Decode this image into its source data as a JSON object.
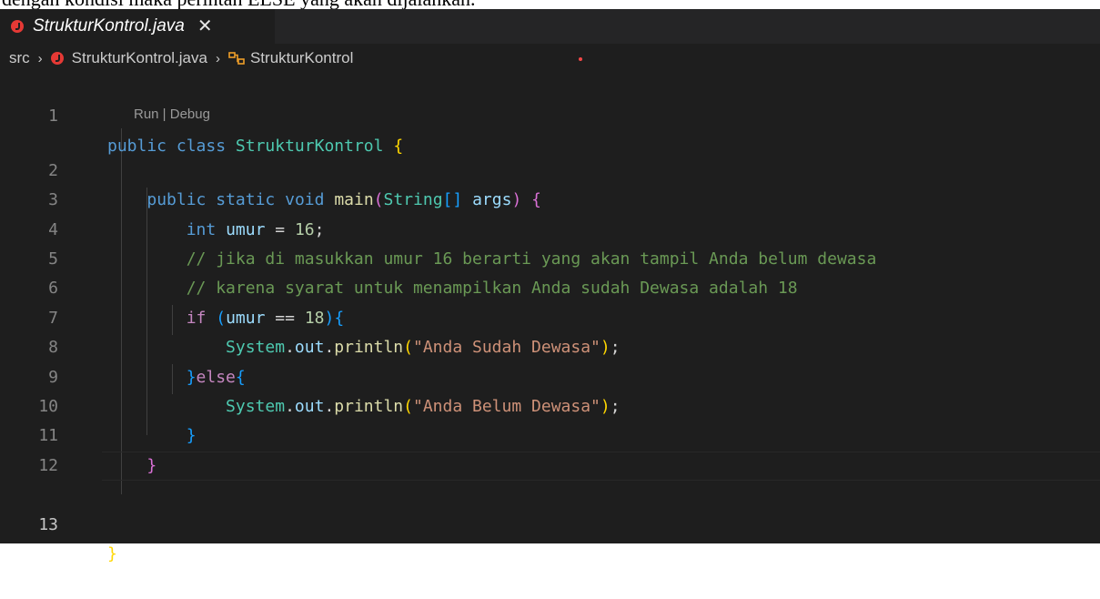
{
  "document_text": "dengan kondisi maka perintah ELSE yang akan dijalankan.",
  "tab": {
    "title": "StrukturKontrol.java",
    "close_glyph": "✕"
  },
  "breadcrumb": {
    "folder": "src",
    "file": "StrukturKontrol.java",
    "symbol": "StrukturKontrol",
    "separator": "›"
  },
  "codelens": "Run | Debug",
  "line_numbers": [
    "1",
    "2",
    "3",
    "4",
    "5",
    "6",
    "7",
    "8",
    "9",
    "10",
    "11",
    "12",
    "13"
  ],
  "code": {
    "l1": {
      "kw1": "public",
      "kw2": "class",
      "name": "StrukturKontrol",
      "brace": "{"
    },
    "l2": {
      "kw1": "public",
      "kw2": "static",
      "kw3": "void",
      "fn": "main",
      "po": "(",
      "type": "String",
      "arr": "[]",
      "param": "args",
      "pc": ")",
      "brace": "{"
    },
    "l3": {
      "type": "int",
      "var": "umur",
      "op": "=",
      "num": "16",
      "semi": ";"
    },
    "l4": "// jika di masukkan umur 16 berarti yang akan tampil Anda belum dewasa",
    "l5": "// karena syarat untuk menampilkan Anda sudah Dewasa adalah 18",
    "l6": {
      "kw": "if",
      "po": "(",
      "var": "umur",
      "op": "==",
      "num": "18",
      "pc": ")",
      "brace": "{"
    },
    "l7": {
      "cls": "System",
      "dot1": ".",
      "field": "out",
      "dot2": ".",
      "fn": "println",
      "po": "(",
      "str": "\"Anda Sudah Dewasa\"",
      "pc": ")",
      "semi": ";"
    },
    "l8": {
      "bc": "}",
      "kw": "else",
      "bo": "{"
    },
    "l9": {
      "cls": "System",
      "dot1": ".",
      "field": "out",
      "dot2": ".",
      "fn": "println",
      "po": "(",
      "str": "\"Anda Belum Dewasa\"",
      "pc": ")",
      "semi": ";"
    },
    "l10": "}",
    "l11": "}",
    "l13": "}"
  },
  "colors": {
    "editor_bg": "#1e1e1e",
    "keyword": "#569cd6",
    "control_keyword": "#c586c0",
    "type": "#4ec9b0",
    "function": "#dcdcaa",
    "variable": "#9cdcfe",
    "number": "#b5cea8",
    "string": "#ce9178",
    "comment": "#6a9955",
    "java_icon": "#e53935"
  },
  "icons": {
    "tab_file": "java-file-icon",
    "breadcrumb_file": "java-file-icon",
    "breadcrumb_symbol": "class-symbol-icon",
    "close": "close-icon"
  }
}
